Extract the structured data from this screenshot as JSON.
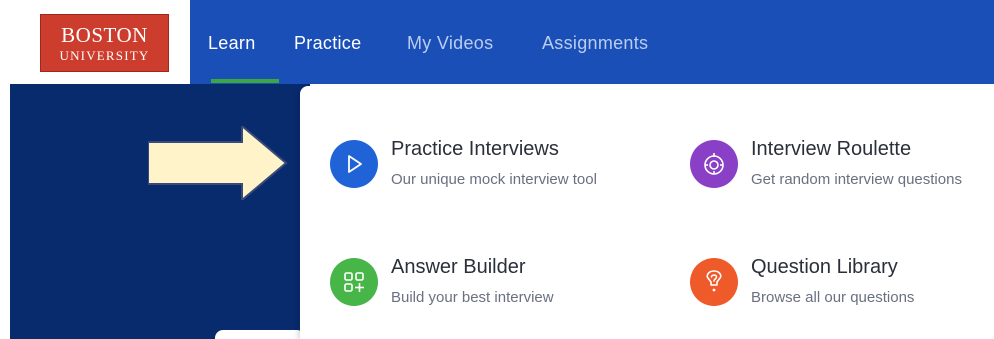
{
  "logo": {
    "line1": "BOSTON",
    "line2": "UNIVERSITY"
  },
  "nav": {
    "items": [
      {
        "label": "Learn"
      },
      {
        "label": "Practice"
      },
      {
        "label": "My Videos"
      },
      {
        "label": "Assignments"
      }
    ]
  },
  "menu": {
    "items": [
      {
        "title": "Practice Interviews",
        "desc": "Our unique mock interview tool",
        "icon": "play-icon",
        "color": "#1f63d6"
      },
      {
        "title": "Interview Roulette",
        "desc": "Get random interview questions",
        "icon": "roulette-icon",
        "color": "#8a3fc7"
      },
      {
        "title": "Answer Builder",
        "desc": "Build your best interview",
        "icon": "builder-blocks-icon",
        "color": "#47b548"
      },
      {
        "title": "Question Library",
        "desc": "Browse all our questions",
        "icon": "question-mark-icon",
        "color": "#ef5a2a"
      }
    ]
  },
  "colors": {
    "topbar": "#1a4fb8",
    "hero": "#082b6e",
    "accent_green": "#3aa83f",
    "arrow_fill": "#fff3c9"
  }
}
